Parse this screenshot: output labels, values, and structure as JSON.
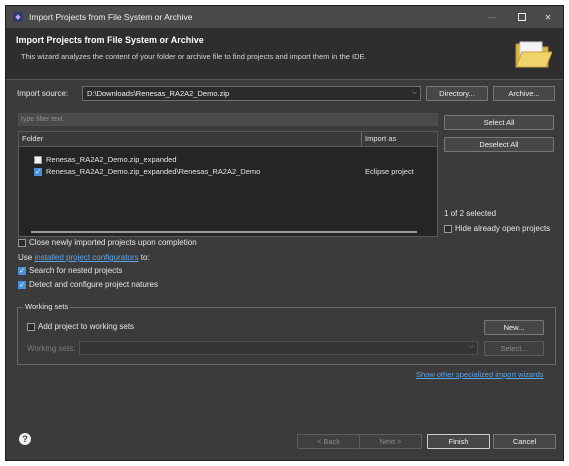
{
  "window": {
    "title": "Import Projects from File System or Archive",
    "controls": {
      "minimize": "—",
      "close": "✕"
    }
  },
  "banner": {
    "title": "Import Projects from File System or Archive",
    "description": "This wizard analyzes the content of your folder or archive file to find projects and import them in the IDE."
  },
  "import_source": {
    "label": "Import source:",
    "value": "D:\\Downloads\\Renesas_RA2A2_Demo.zip",
    "directory_button": "Directory...",
    "archive_button": "Archive..."
  },
  "filter": {
    "placeholder": "type filter text"
  },
  "table": {
    "columns": [
      "Folder",
      "Import as"
    ],
    "rows": [
      {
        "folder": "Renesas_RA2A2_Demo.zip_expanded",
        "import_as": "",
        "checked": false
      },
      {
        "folder": "Renesas_RA2A2_Demo.zip_expanded\\Renesas_RA2A2_Demo",
        "import_as": "Eclipse project",
        "checked": true
      }
    ]
  },
  "side": {
    "select_all": "Select All",
    "deselect_all": "Deselect All",
    "selection_count": "1 of 2 selected",
    "hide_open": "Hide already open projects"
  },
  "options": {
    "close_imported": "Close newly imported projects upon completion",
    "use_prefix": "Use",
    "configurators_link": "installed project configurators",
    "use_suffix": "to:",
    "search_nested": "Search for nested projects",
    "detect_natures": "Detect and configure project natures"
  },
  "working_sets": {
    "title": "Working sets",
    "add_label": "Add project to working sets",
    "new_button": "New...",
    "sets_label": "Working sets:",
    "select_button": "Select..."
  },
  "footer": {
    "show_wizards_link": "Show other specialized import wizards",
    "help_icon": "?",
    "back": "< Back",
    "next": "Next >",
    "finish": "Finish",
    "cancel": "Cancel"
  },
  "icons": {
    "app": "eclipse-icon",
    "folder": "folder-open-icon",
    "help": "help-icon"
  },
  "colors": {
    "accent": "#4a90d9",
    "link": "#5da3e8",
    "background": "#3b3b3b"
  }
}
